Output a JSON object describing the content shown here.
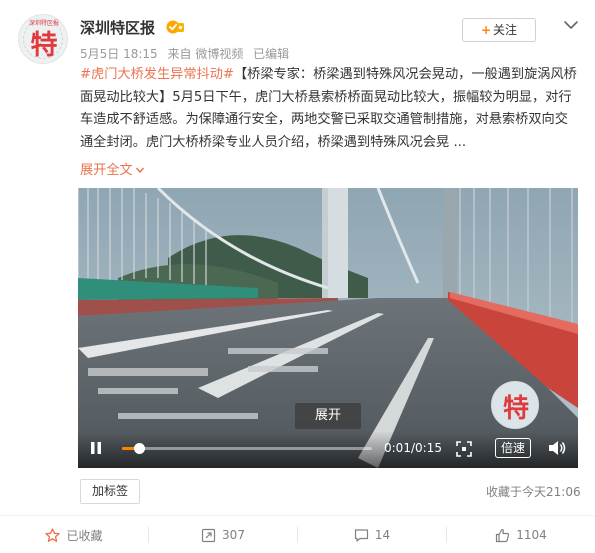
{
  "header": {
    "author_name": "深圳特区报",
    "avatar_text": "特",
    "avatar_small_text": "深圳特区报",
    "timestamp": "5月5日 18:15",
    "source": "来自 微博视频",
    "edited": "已编辑",
    "follow_label": "关注"
  },
  "post": {
    "topic": "#虎门大桥发生异常抖动#",
    "text": "【桥梁专家：桥梁遇到特殊风况会晃动，一般遇到旋涡风桥面晃动比较大】5月5日下午，虎门大桥悬索桥桥面晃动比较大，振幅较为明显，对行车造成不舒适感。为保障通行安全，两地交警已采取交通管制措施，对悬索桥双向交通全封闭。虎门大桥桥梁专业人员介绍，桥梁遇到特殊风况会晃 ...",
    "expand_label": "展开全文"
  },
  "video": {
    "overlay_label": "展开",
    "watermark_text": "特",
    "progress": 0.067,
    "current_time": "0:01",
    "duration": "0:15",
    "speed_label": "倍速"
  },
  "tag_button_label": "加标签",
  "fav_time": "收藏于今天21:06",
  "actions": {
    "favorited": "已收藏",
    "repost_count": "307",
    "comment_count": "14",
    "like_count": "1104"
  },
  "colors": {
    "accent": "#eb7350",
    "follow_plus": "#ff8200",
    "progress": "#ff8200",
    "verified": "#ffa500"
  }
}
